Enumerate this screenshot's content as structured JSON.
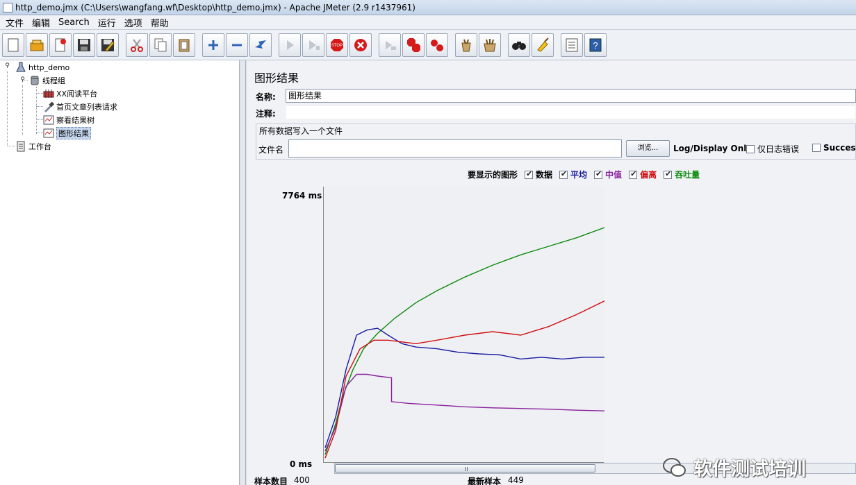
{
  "window": {
    "title": "http_demo.jmx (C:\\Users\\wangfang.wf\\Desktop\\http_demo.jmx) - Apache JMeter (2.9 r1437961)"
  },
  "menu": [
    "文件",
    "编辑",
    "Search",
    "运行",
    "选项",
    "帮助"
  ],
  "toolbar": [
    "new-icon",
    "open-icon",
    "close-icon",
    "save-icon",
    "save-as-icon",
    "cut-icon",
    "copy-icon",
    "paste-icon",
    "expand-icon",
    "collapse-icon",
    "toggle-icon",
    "start-icon",
    "start-no-pause-icon",
    "stop-icon",
    "shutdown-icon",
    "remote-start-icon",
    "remote-stop-icon",
    "remote-shutdown-icon",
    "clear-icon",
    "clear-all-icon",
    "search-icon",
    "reset-search-icon",
    "function-helper-icon",
    "help-icon"
  ],
  "tree": {
    "root": "http_demo",
    "thread_group": "线程组",
    "items": [
      "XX阅读平台",
      "首页文章列表请求",
      "察看结果树",
      "图形结果"
    ],
    "workbench": "工作台",
    "selected_index": 3
  },
  "panel": {
    "title": "图形结果",
    "name_label": "名称:",
    "name_value": "图形结果",
    "comment_label": "注释:",
    "comment_value": "",
    "file_section_title": "所有数据写入一个文件",
    "filename_label": "文件名",
    "filename_value": "",
    "browse_label": "浏览...",
    "log_display_label": "Log/Display Only:",
    "errors_only_label": "仅日志错误",
    "errors_only_checked": false,
    "success_label": "Successes",
    "success_checked": false
  },
  "graph_options": {
    "label": "要显示的图形",
    "items": [
      {
        "label": "数据",
        "checked": true,
        "color": "#000000"
      },
      {
        "label": "平均",
        "checked": true,
        "color": "#1a1aa0"
      },
      {
        "label": "中值",
        "checked": true,
        "color": "#8a1f9c"
      },
      {
        "label": "偏离",
        "checked": true,
        "color": "#d01010"
      },
      {
        "label": "吞吐量",
        "checked": true,
        "color": "#0b8a0b"
      }
    ]
  },
  "chart_data": {
    "type": "line",
    "ymax_label": "7764 ms",
    "ymin_label": "0 ms",
    "ylim": [
      0,
      7764
    ],
    "xlim": [
      0,
      400
    ],
    "series": [
      {
        "name": "吞吐量",
        "color": "#0b8a0b",
        "x": [
          0,
          15,
          25,
          40,
          55,
          75,
          100,
          130,
          160,
          200,
          240,
          280,
          320,
          360,
          400
        ],
        "y": [
          200,
          1100,
          1900,
          2700,
          3300,
          3750,
          4200,
          4650,
          5000,
          5400,
          5750,
          6050,
          6300,
          6550,
          6850
        ]
      },
      {
        "name": "平均",
        "color": "#1a1aa0",
        "x": [
          0,
          15,
          30,
          45,
          60,
          75,
          90,
          110,
          130,
          160,
          190,
          220,
          250,
          280,
          310,
          340,
          370,
          400
        ],
        "y": [
          400,
          1300,
          2700,
          3700,
          3850,
          3900,
          3700,
          3450,
          3350,
          3300,
          3200,
          3150,
          3120,
          3000,
          3050,
          3000,
          3050,
          3050
        ]
      },
      {
        "name": "中值",
        "color": "#8a1f9c",
        "x": [
          0,
          15,
          30,
          45,
          60,
          75,
          95,
          95,
          120,
          160,
          200,
          240,
          280,
          320,
          360,
          400
        ],
        "y": [
          300,
          1000,
          2200,
          2550,
          2550,
          2500,
          2450,
          1750,
          1700,
          1650,
          1600,
          1570,
          1550,
          1530,
          1500,
          1480
        ]
      },
      {
        "name": "偏离",
        "color": "#d01010",
        "x": [
          0,
          15,
          30,
          50,
          70,
          90,
          110,
          130,
          160,
          200,
          240,
          280,
          320,
          360,
          400
        ],
        "y": [
          100,
          900,
          2500,
          3300,
          3550,
          3550,
          3500,
          3450,
          3550,
          3700,
          3800,
          3700,
          3950,
          4300,
          4700
        ]
      }
    ]
  },
  "bottom": {
    "sample_count_label": "样本数目",
    "sample_count_value": "400",
    "latest_sample_label": "最新样本",
    "latest_sample_value": "449"
  },
  "watermark": {
    "text": "软件测试培训"
  }
}
